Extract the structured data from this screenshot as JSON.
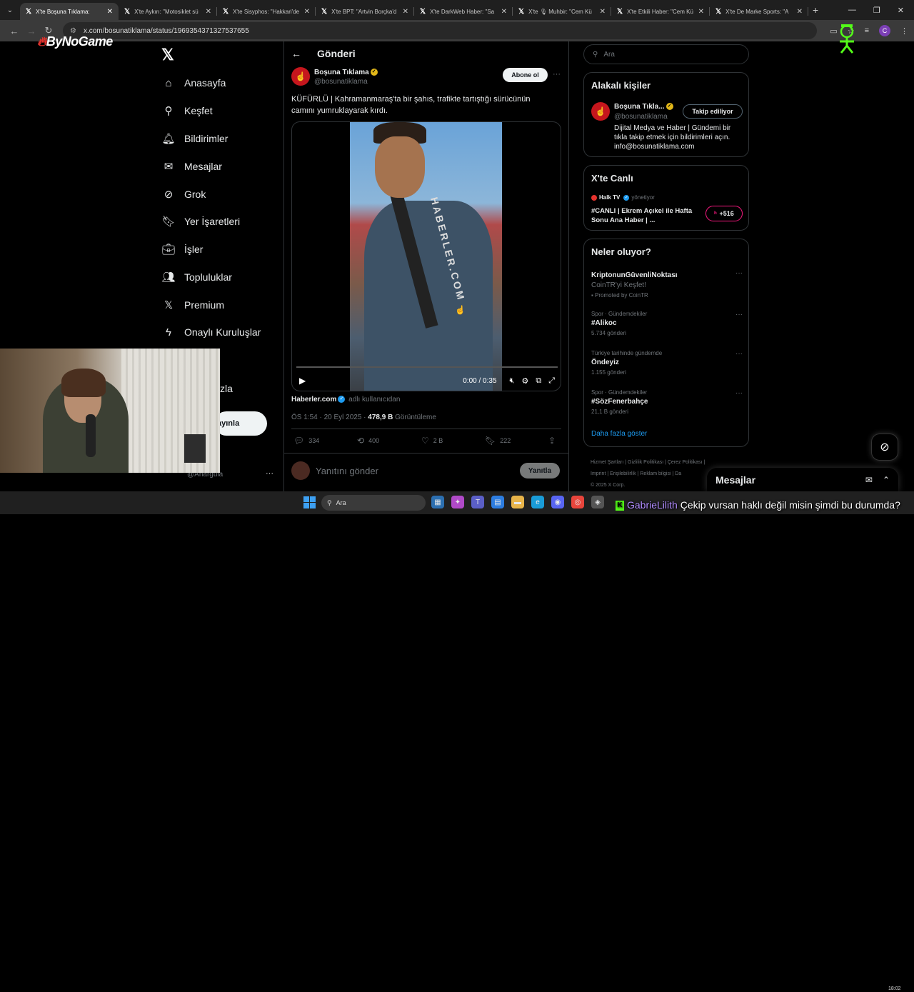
{
  "browser": {
    "tabs": [
      {
        "title": "X'te Boşuna Tıklama:",
        "active": true
      },
      {
        "title": "X'te Aykırı: \"Motosiklet sü",
        "active": false
      },
      {
        "title": "X'te Sisyphos: \"Hakkari'de",
        "active": false
      },
      {
        "title": "X'te BPT: \"Artvin Borçka'd",
        "active": false
      },
      {
        "title": "X'te DarkWeb Haber: \"Sa",
        "active": false
      },
      {
        "title": "X'te 🎙 Muhbir: \"Cem Kü",
        "active": false
      },
      {
        "title": "X'te Etkili Haber: \"Cem Kü",
        "active": false
      },
      {
        "title": "X'te De Marke Sports: \"A",
        "active": false
      }
    ],
    "url": "x.com/bosunatiklama/status/1969354371327537655",
    "profile_initial": "C"
  },
  "overlay": {
    "brand": "ByNoGame"
  },
  "nav": {
    "items": [
      {
        "label": "Anasayfa",
        "icon": "home-icon",
        "glyph": "⌂"
      },
      {
        "label": "Keşfet",
        "icon": "search-icon",
        "glyph": "⚲"
      },
      {
        "label": "Bildirimler",
        "icon": "bell-icon",
        "glyph": "🔔︎"
      },
      {
        "label": "Mesajlar",
        "icon": "mail-icon",
        "glyph": "✉"
      },
      {
        "label": "Grok",
        "icon": "grok-icon",
        "glyph": "⊘"
      },
      {
        "label": "Yer İşaretleri",
        "icon": "bookmark-icon",
        "glyph": "🔖︎"
      },
      {
        "label": "İşler",
        "icon": "briefcase-icon",
        "glyph": "💼︎"
      },
      {
        "label": "Topluluklar",
        "icon": "communities-icon",
        "glyph": "👥︎"
      },
      {
        "label": "Premium",
        "icon": "x-icon",
        "glyph": "𝕏"
      },
      {
        "label": "Onaylı Kuruluşlar",
        "icon": "lightning-icon",
        "glyph": "ϟ"
      }
    ],
    "partial_label": "zla",
    "post_button_partial": "ayınla",
    "account_handle": "@Anarguia"
  },
  "post": {
    "header_title": "Gönderi",
    "author_name": "Boşuna Tıklama",
    "author_handle": "@bosunatiklama",
    "subscribe_label": "Abone ol",
    "text": "KÜFÜRLÜ | Kahramanmaraş'ta bir şahıs, trafikte tartıştığı sürücünün camını yumruklayarak kırdı.",
    "video_watermark": "HABERLER.COM",
    "video_time": "0:00 / 0:35",
    "video_progress": 0,
    "source_name": "Haberler.com",
    "source_sub": "adlı kullanıcıdan",
    "timestamp": "ÖS 1:54 · 20 Eyl 2025 · ",
    "views_count": "478,9 B",
    "views_label": " Görüntüleme",
    "replies": "334",
    "reposts": "400",
    "likes": "2 B",
    "bookmarks": "222",
    "reply_placeholder": "Yanıtını gönder",
    "reply_button": "Yanıtla"
  },
  "sidebar": {
    "search_placeholder": "Ara",
    "related": {
      "title": "Alakalı kişiler",
      "name": "Boşuna Tıkla...",
      "handle": "@bosunatiklama",
      "follow_label": "Takip ediliyor",
      "bio": "Dijital Medya ve Haber | Gündemi bir tıkla takip etmek için bildirimleri açın. info@bosunatiklama.com"
    },
    "live": {
      "title": "X'te Canlı",
      "host": "Halk TV",
      "host_suffix": "yönetiyor",
      "stream_title": "#CANLI | Ekrem Açıkel ile Hafta Sonu Ana Haber | ...",
      "listeners": "+516"
    },
    "trends": {
      "title": "Neler oluyor?",
      "items": [
        {
          "category": "",
          "name": "KriptonunGüvenliNoktası",
          "sub": "CoinTR'yi Keşfet!",
          "count": "Promoted by CoinTR",
          "promoted": true
        },
        {
          "category": "Spor · Gündemdekiler",
          "name": "#Alikoc",
          "sub": "",
          "count": "5.734 gönderi",
          "promoted": false
        },
        {
          "category": "Türkiye tarihinde gündemde",
          "name": "Öndeyiz",
          "sub": "",
          "count": "1.155 gönderi",
          "promoted": false
        },
        {
          "category": "Spor · Gündemdekiler",
          "name": "#SözFenerbahçe",
          "sub": "",
          "count": "21,1 B gönderi",
          "promoted": false
        }
      ],
      "more": "Daha fazla göster"
    },
    "footer": {
      "line1": "Hizmet Şartları  |  Gizlilik Politikası  |  Çerez Politikası  |",
      "line2": "Imprint  |  Erişilebilirlik  |  Reklam bilgisi  |  Da",
      "line3": "© 2025 X Corp."
    }
  },
  "messages_drawer": {
    "title": "Mesajlar"
  },
  "taskbar": {
    "search_placeholder": "Ara",
    "time": "18:02"
  },
  "chat": {
    "user": "GabrieLilith",
    "message": "Çekip vursan haklı değil misin şimdi bu durumda?"
  },
  "colors": {
    "accent": "#1d9bf0",
    "brand_red": "#c5161d",
    "live_pink": "#f91880"
  }
}
